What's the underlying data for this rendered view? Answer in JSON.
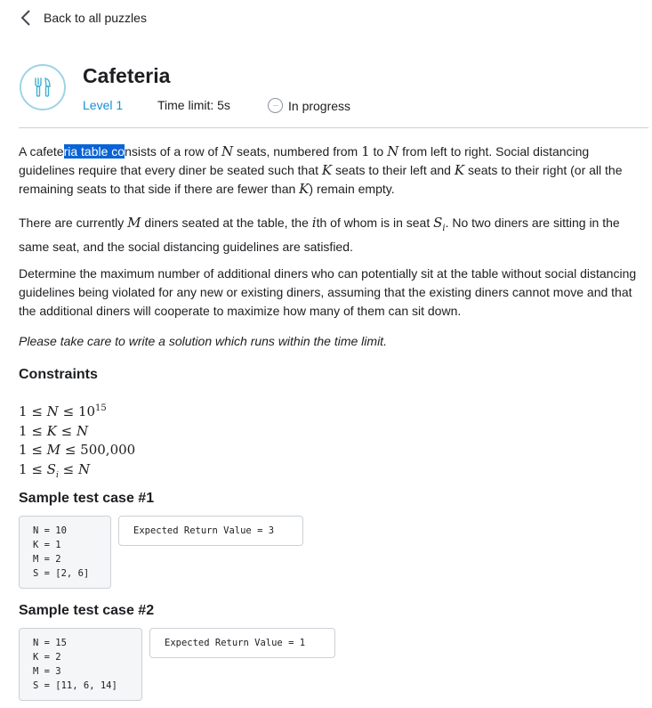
{
  "nav": {
    "back_label": "Back to all puzzles"
  },
  "puzzle": {
    "title": "Cafeteria",
    "level": "Level 1",
    "time_limit": "Time limit: 5s",
    "status": "In progress"
  },
  "statement": {
    "p1_a": "A cafete",
    "p1_sel": "ria table co",
    "p1_b": "nsists of a row of ",
    "N": "N",
    "p1_c": " seats, numbered from ",
    "one": "1",
    "p1_d": " to ",
    "p1_e": " from left to right. Social distancing guidelines require that every diner be seated such that ",
    "K": "K",
    "p1_f": " seats to their left and ",
    "p1_g": " seats to their right (or all the remaining seats to that side if there are fewer than ",
    "p1_h": ") remain empty.",
    "p2_a": "There are currently ",
    "M": "M",
    "p2_b": " diners seated at the table, the ",
    "i": "i",
    "p2_c": "th of whom is in seat ",
    "Si": "S",
    "Si_sub": "i",
    "p2_d": ". No two diners are sitting in the same seat, and the social distancing guidelines are satisfied.",
    "p3": "Determine the maximum number of additional diners who can potentially sit at the table without social distancing guidelines being violated for any new or existing diners, assuming that the existing diners cannot move and that the additional diners will cooperate to maximize how many of them can sit down.",
    "p4": "Please take care to write a solution which runs within the time limit."
  },
  "constraints": {
    "heading": "Constraints",
    "le": "≤",
    "c1_exp": "15",
    "c1_base": "10",
    "c3_max": "500,000"
  },
  "samples": [
    {
      "heading": "Sample test case #1",
      "input": [
        "N = 10",
        "K = 1",
        "M = 2",
        "S = [2, 6]"
      ],
      "expected": "Expected Return Value = 3"
    },
    {
      "heading": "Sample test case #2",
      "input": [
        "N = 15",
        "K = 2",
        "M = 3",
        "S = [11, 6, 14]"
      ],
      "expected": "Expected Return Value = 1"
    }
  ]
}
